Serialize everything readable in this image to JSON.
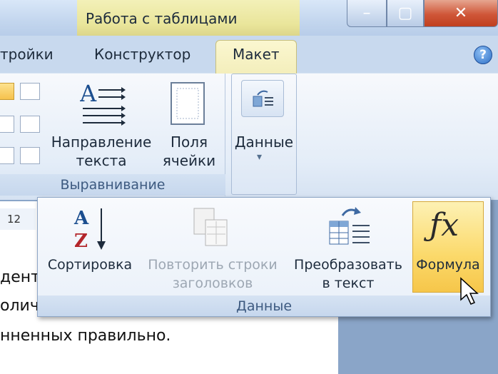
{
  "window": {
    "context_tab_title": "Работа с таблицами",
    "minimize_label": "–",
    "maximize_label": "▢",
    "close_label": "✕"
  },
  "tabs": [
    {
      "label": "тройки"
    },
    {
      "label": "Конструктор"
    },
    {
      "label": "Макет",
      "selected": true
    }
  ],
  "help_label": "?",
  "groups": {
    "alignment": {
      "label": "Выравнивание",
      "text_direction": {
        "line1": "Направление",
        "line2": "текста"
      },
      "cell_margins": {
        "line1": "Поля",
        "line2": "ячейки"
      }
    },
    "data": {
      "label": "Данные",
      "arrow": "▾"
    }
  },
  "dropdown": {
    "label": "Данные",
    "sort": "Сортировка",
    "repeat_headers": {
      "line1": "Повторить строки",
      "line2": "заголовков",
      "enabled": false
    },
    "convert": {
      "line1": "Преобразовать",
      "line2": "в текст"
    },
    "formula": "Формула"
  },
  "document": {
    "font_size": "12",
    "lines": [
      "дент",
      "олич",
      "нненных правильно."
    ]
  },
  "colors": {
    "context_tab": "#e9e59a",
    "formula_highlight": "#fbd96a",
    "close_button": "#cf5638"
  }
}
